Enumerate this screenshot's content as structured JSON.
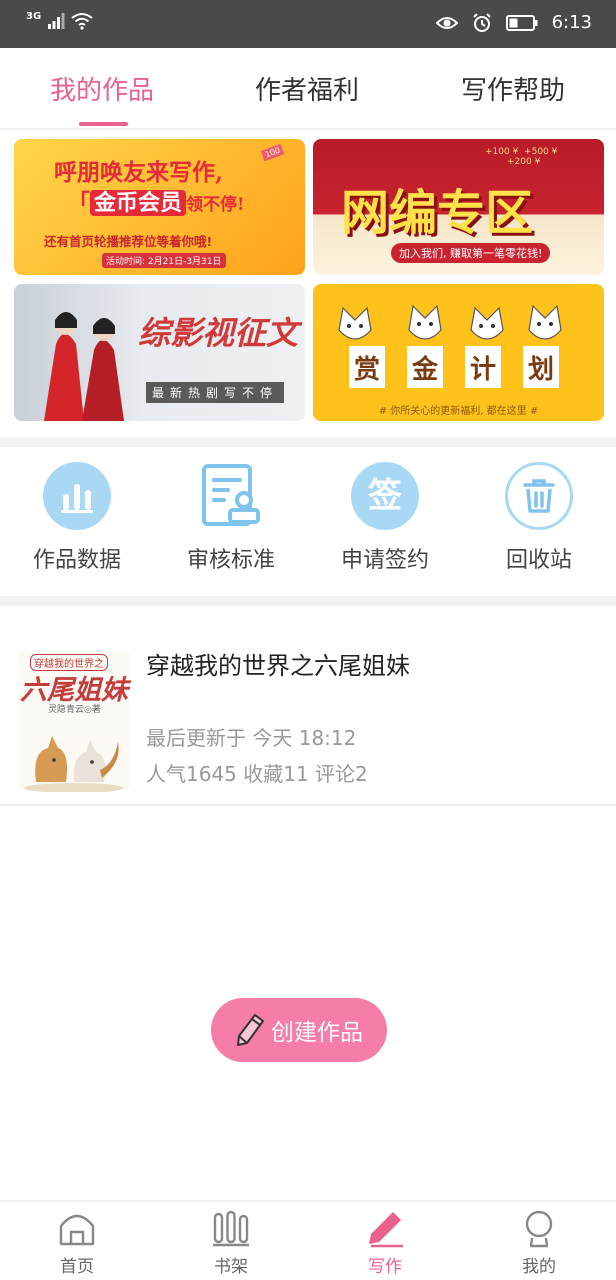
{
  "status_bar": {
    "network": "3G",
    "time": "6:13"
  },
  "tabs": [
    {
      "label": "我的作品",
      "active": true
    },
    {
      "label": "作者福利",
      "active": false
    },
    {
      "label": "写作帮助",
      "active": false
    }
  ],
  "banners": {
    "invite": {
      "line1": "呼朋唤友来写作,",
      "line2_open": "「",
      "line2_em": "金币会员",
      "line2_rest": "领不停!",
      "line3": "还有首页轮播推荐位等着你哦!",
      "date": "活动时间: 2月21日-3月31日",
      "badge": "100"
    },
    "web_editor": {
      "title": "网编专区",
      "sub": "加入我们, 赚取第一笔零花钱!",
      "coins": [
        "+100 ¥",
        "+500 ¥",
        "+200 ¥"
      ]
    },
    "drama": {
      "title": "综影视征文",
      "sub": "最新热剧写不停"
    },
    "bounty": {
      "chars": [
        "赏",
        "金",
        "计",
        "划"
      ],
      "sub": "# 你所关心的更新福利, 都在这里 #"
    }
  },
  "tools": [
    {
      "label": "作品数据",
      "icon": "bar-chart-icon"
    },
    {
      "label": "审核标准",
      "icon": "review-document-icon"
    },
    {
      "label": "申请签约",
      "icon": "sign-contract-icon"
    },
    {
      "label": "回收站",
      "icon": "trash-icon"
    }
  ],
  "book": {
    "title": "穿越我的世界之六尾姐妹",
    "updated": "最后更新于 今天 18:12",
    "stats": "人气1645 收藏11 评论2",
    "cover": {
      "top": "穿越我的世界之",
      "title": "六尾姐妹",
      "author": "灵隐青云◎著"
    }
  },
  "create_button": {
    "label": "创建作品"
  },
  "colors": {
    "accent": "#e8628c",
    "button": "#f57da8",
    "tool_icon_bg": "#a8d8f4"
  },
  "bottom_nav": [
    {
      "label": "首页",
      "icon": "home-icon"
    },
    {
      "label": "书架",
      "icon": "bookshelf-icon"
    },
    {
      "label": "写作",
      "icon": "pencil-icon",
      "active": true
    },
    {
      "label": "我的",
      "icon": "profile-icon"
    }
  ]
}
